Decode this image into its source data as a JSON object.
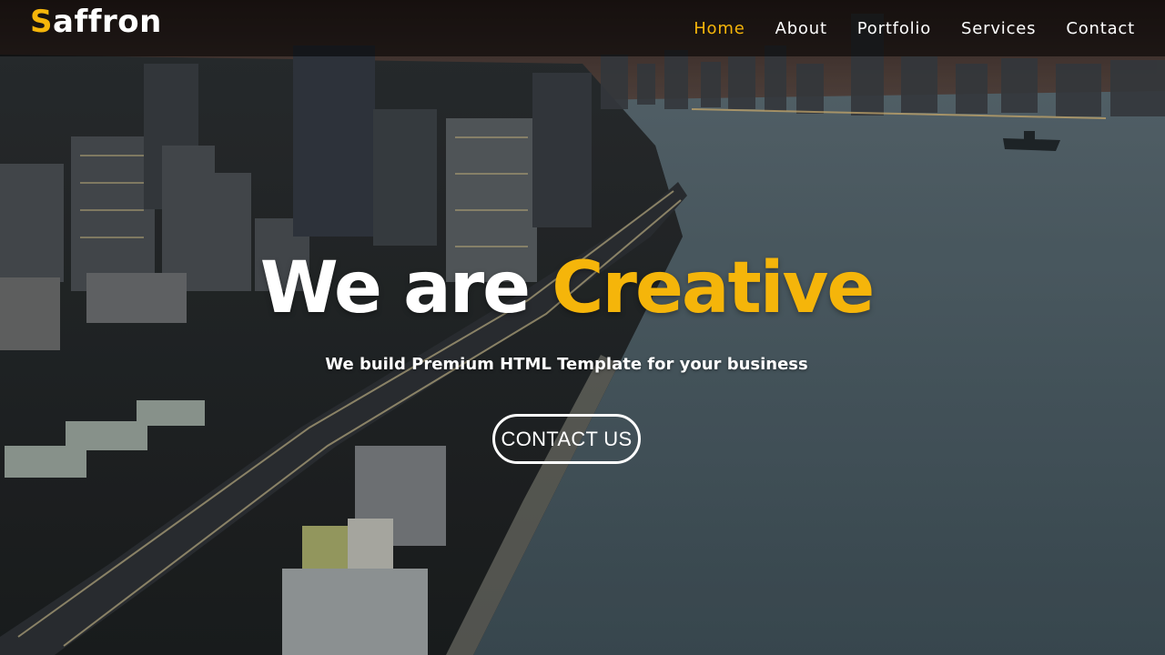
{
  "brand": {
    "initial": "S",
    "rest": "affron"
  },
  "nav": {
    "items": [
      {
        "label": "Home",
        "active": true
      },
      {
        "label": "About",
        "active": false
      },
      {
        "label": "Portfolio",
        "active": false
      },
      {
        "label": "Services",
        "active": false
      },
      {
        "label": "Contact",
        "active": false
      }
    ]
  },
  "hero": {
    "headline_plain": "We are ",
    "headline_accent": "Creative",
    "subheadline": "We build Premium HTML Template for your business",
    "cta_label": "CONTACT US"
  },
  "colors": {
    "accent": "#f5b50a",
    "text": "#ffffff",
    "nav_bg": "rgba(0,0,0,0.55)"
  }
}
